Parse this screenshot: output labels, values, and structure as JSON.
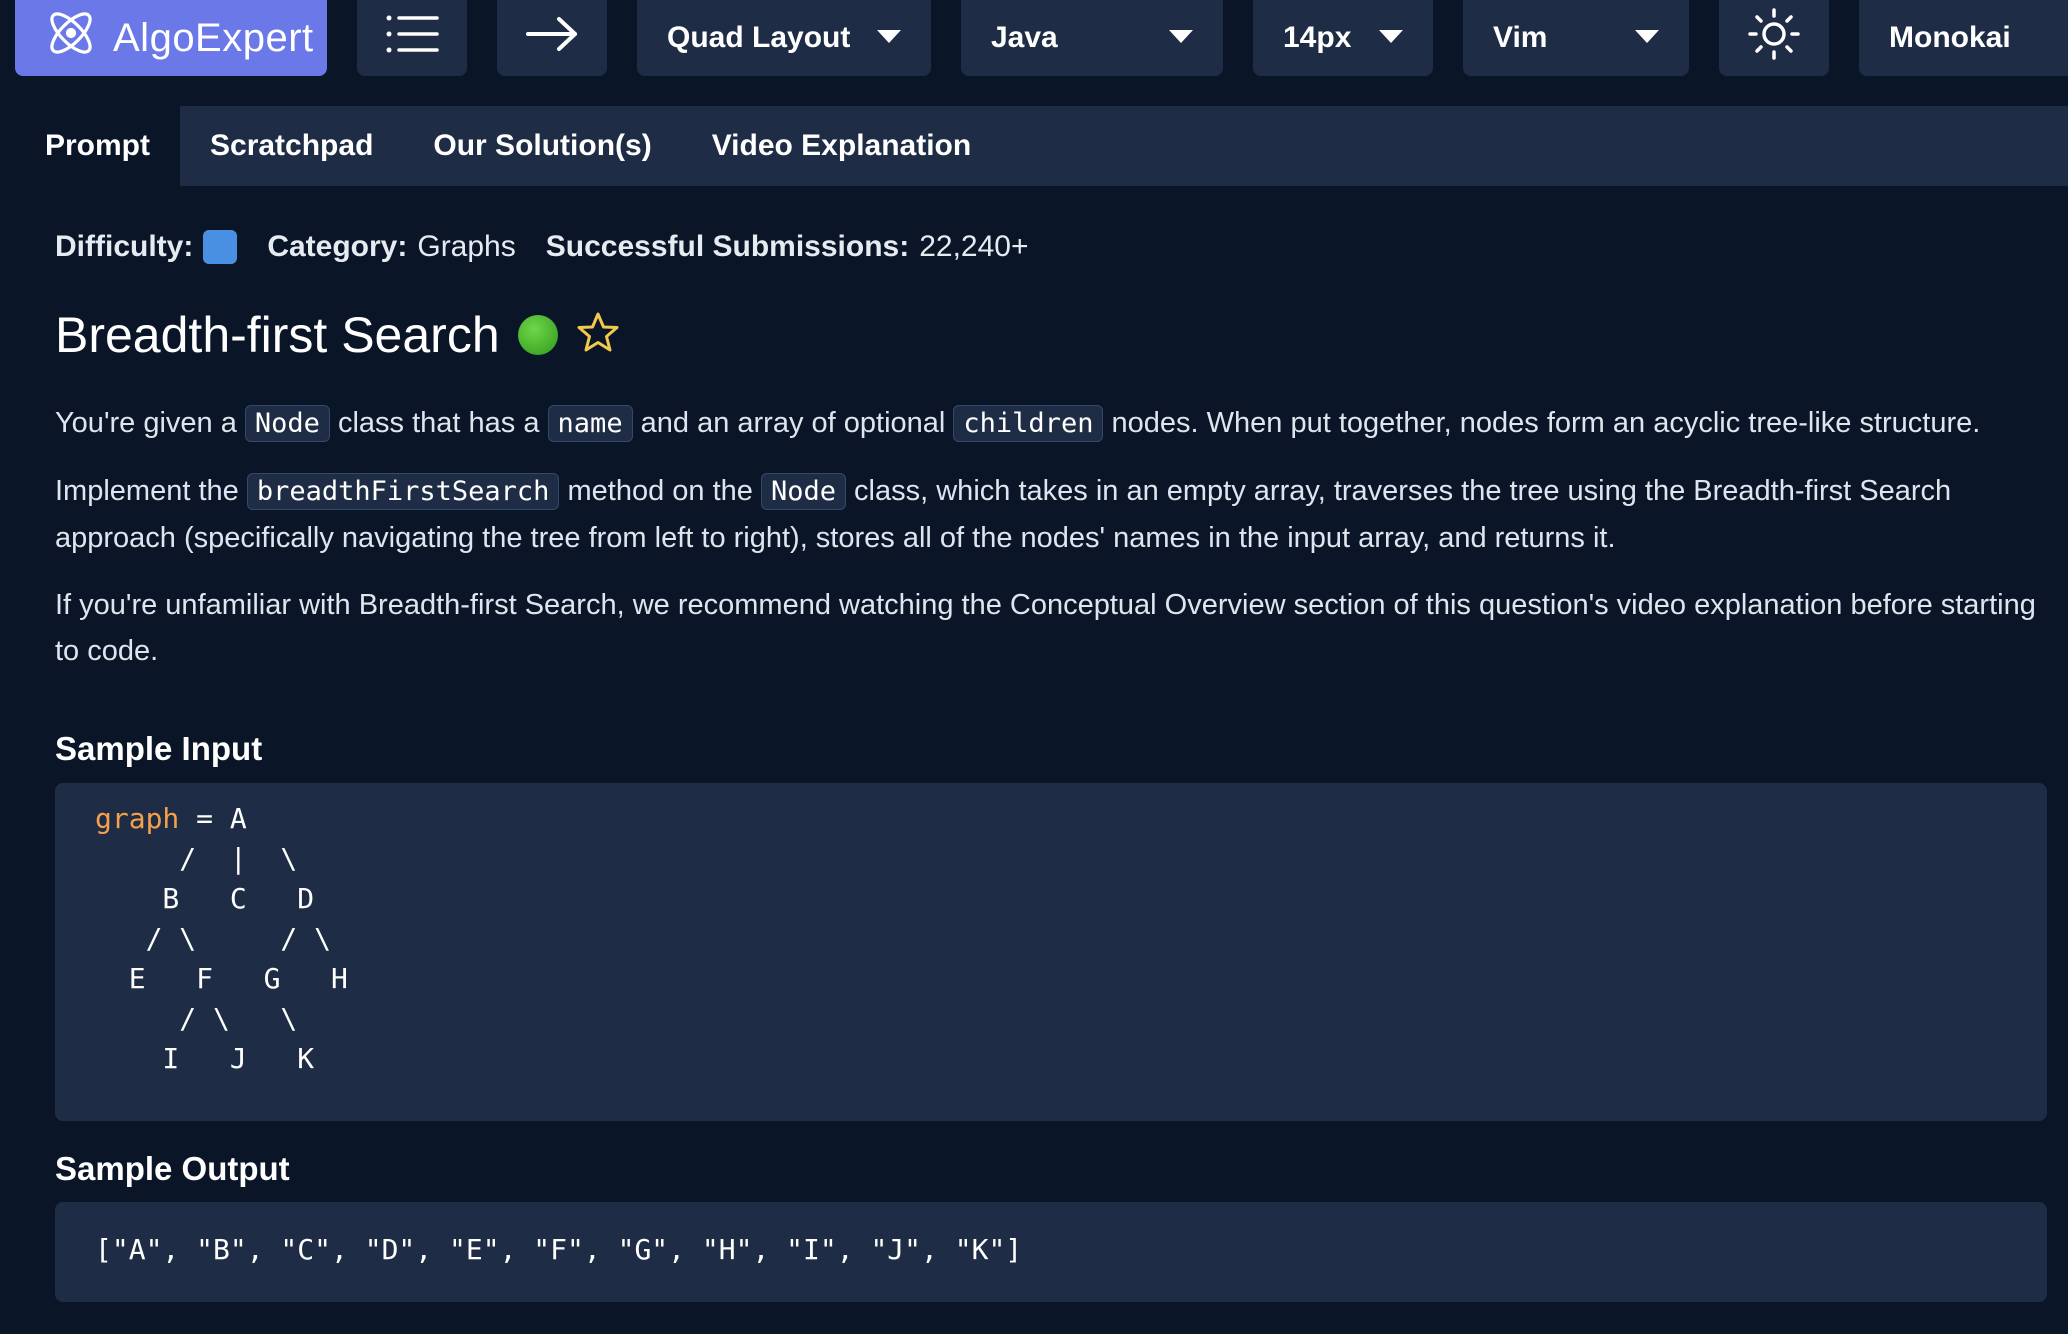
{
  "toolbar": {
    "logo_label": "AlgoExpert",
    "layout_label": "Quad Layout",
    "language_label": "Java",
    "font_size_label": "14px",
    "keybinding_label": "Vim",
    "theme_label": "Monokai",
    "icons": [
      "atom-logo-icon",
      "menu-list-icon",
      "arrow-right-icon",
      "sun-icon"
    ],
    "accent_color": "#6b78e8"
  },
  "tabs": [
    {
      "label": "Prompt",
      "active": true
    },
    {
      "label": "Scratchpad",
      "active": false
    },
    {
      "label": "Our Solution(s)",
      "active": false
    },
    {
      "label": "Video Explanation",
      "active": false
    }
  ],
  "meta": {
    "difficulty_label": "Difficulty:",
    "difficulty_color": "#4a90e2",
    "category_label": "Category:",
    "category_value": "Graphs",
    "submissions_label": "Successful Submissions:",
    "submissions_value": "22,240+"
  },
  "question": {
    "title": "Breadth-first Search",
    "status_color": "#3cb52a",
    "p1": {
      "t1": "You're given a ",
      "c1": "Node",
      "t2": " class that has a ",
      "c2": "name",
      "t3": " and an array of optional ",
      "c3": "children",
      "t4": " nodes. When put together, nodes form an acyclic tree-like structure."
    },
    "p2": {
      "t1": "Implement the ",
      "c1": "breadthFirstSearch",
      "t2": " method on the ",
      "c2": "Node",
      "t3": " class, which takes in an empty array, traverses the tree using the Breadth-first Search approach (specifically navigating the tree from left to right), stores all of the nodes' names in the input array, and returns it."
    },
    "p3": "If you're unfamiliar with Breadth-first Search, we recommend watching the Conceptual Overview section of this question's video explanation before starting to code."
  },
  "sample_input": {
    "heading": "Sample Input",
    "var_name": "graph",
    "code": " = A\n     /  |  \\\n    B   C   D\n   / \\     / \\\n  E   F   G   H\n     / \\   \\\n    I   J   K"
  },
  "sample_output": {
    "heading": "Sample Output",
    "code": "[\"A\", \"B\", \"C\", \"D\", \"E\", \"F\", \"G\", \"H\", \"I\", \"J\", \"K\"]"
  }
}
